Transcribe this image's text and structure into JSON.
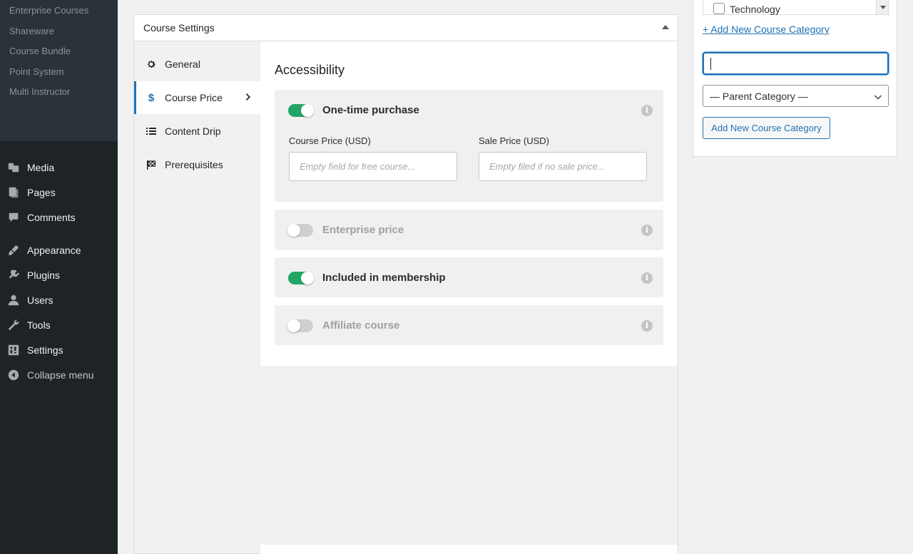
{
  "admin_menu": {
    "submenu": [
      "Enterprise Courses",
      "Shareware",
      "Course Bundle",
      "Point System",
      "Multi Instructor"
    ],
    "items": [
      {
        "label": "Media",
        "icon": "media-icon"
      },
      {
        "label": "Pages",
        "icon": "pages-icon"
      },
      {
        "label": "Comments",
        "icon": "comments-icon"
      },
      {
        "label": "Appearance",
        "icon": "appearance-icon"
      },
      {
        "label": "Plugins",
        "icon": "plugins-icon"
      },
      {
        "label": "Users",
        "icon": "users-icon"
      },
      {
        "label": "Tools",
        "icon": "tools-icon"
      },
      {
        "label": "Settings",
        "icon": "settings-icon"
      },
      {
        "label": "Collapse menu",
        "icon": "collapse-icon"
      }
    ]
  },
  "course_settings": {
    "title": "Course Settings",
    "tabs": [
      {
        "label": "General",
        "icon": "gear-icon"
      },
      {
        "label": "Course Price",
        "icon": "dollar-icon",
        "active": true
      },
      {
        "label": "Content Drip",
        "icon": "list-icon"
      },
      {
        "label": "Prerequisites",
        "icon": "flag-icon"
      }
    ],
    "section_title": "Accessibility",
    "options": [
      {
        "label": "One-time purchase",
        "enabled": true
      },
      {
        "label": "Enterprise price",
        "enabled": false
      },
      {
        "label": "Included in membership",
        "enabled": true
      },
      {
        "label": "Affiliate course",
        "enabled": false
      }
    ],
    "course_price": {
      "label": "Course Price (USD)",
      "value": "",
      "placeholder": "Empty field for free course..."
    },
    "sale_price": {
      "label": "Sale Price (USD)",
      "value": "",
      "placeholder": "Empty filed if no sale price..."
    },
    "info_glyph": "i"
  },
  "categories": {
    "visible_item": "Technology",
    "add_link": "+ Add New Course Category",
    "new_name_value": "",
    "parent_select": "— Parent Category —",
    "add_button": "Add New Course Category"
  },
  "colors": {
    "accent": "#2271b1",
    "toggle_on": "#21a665",
    "toggle_off": "#cfcfcf",
    "sidebar_bg": "#1d2327"
  }
}
